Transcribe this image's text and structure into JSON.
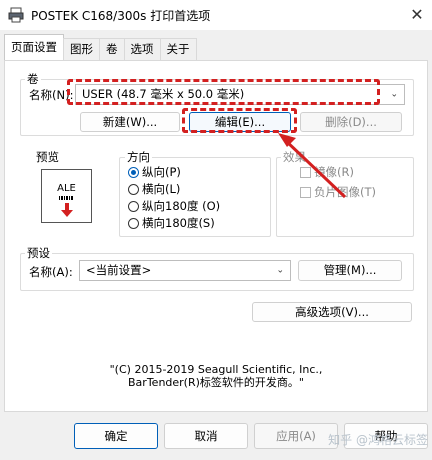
{
  "window": {
    "title": "POSTEK C168/300s 打印首选项",
    "close_glyph": "✕"
  },
  "tabs": [
    {
      "label": "页面设置",
      "active": true
    },
    {
      "label": "图形",
      "active": false
    },
    {
      "label": "卷",
      "active": false
    },
    {
      "label": "选项",
      "active": false
    },
    {
      "label": "关于",
      "active": false
    }
  ],
  "roll": {
    "group_label": "卷",
    "name_label": "名称(N):",
    "name_value": "USER (48.7 毫米 x 50.0 毫米)",
    "new_button": "新建(W)...",
    "edit_button": "编辑(E)...",
    "delete_button": "删除(D)..."
  },
  "preview": {
    "label": "预览",
    "card_text": "ALE"
  },
  "orientation": {
    "label": "方向",
    "options": [
      {
        "label": "纵向(P)",
        "selected": true
      },
      {
        "label": "横向(L)",
        "selected": false
      },
      {
        "label": "纵向180度 (O)",
        "selected": false
      },
      {
        "label": "横向180度(S)",
        "selected": false
      }
    ]
  },
  "effects": {
    "label": "效果",
    "options": [
      {
        "label": "镜像(R)"
      },
      {
        "label": "负片图像(T)"
      }
    ]
  },
  "preset": {
    "label": "预设",
    "name_label": "名称(A):",
    "value": "<当前设置>",
    "manage_button": "管理(M)..."
  },
  "advanced_button": "高级选项(V)...",
  "copyright": {
    "line1": "\"(C) 2015-2019 Seagull Scientific, Inc.,",
    "line2": "BarTender(R)标签软件的开发商。\""
  },
  "footer": {
    "ok": "确定",
    "cancel": "取消",
    "apply": "应用(A)",
    "help": "帮助"
  },
  "watermark": "知乎 @鸿格云标签",
  "colors": {
    "annotation_red": "#d32020",
    "accent": "#005fb8"
  }
}
